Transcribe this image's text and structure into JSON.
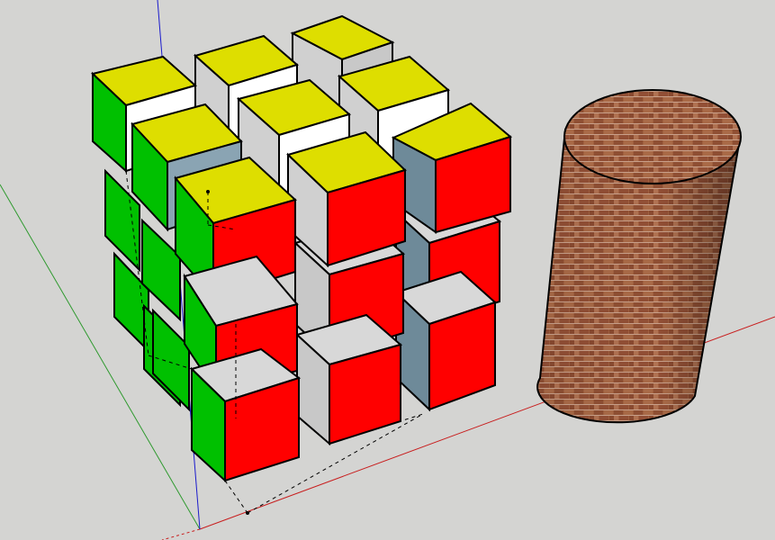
{
  "viewport": {
    "background": "#d4d4d2",
    "axis_colors": {
      "red": "#c81e1e",
      "green": "#2f9a2f",
      "blue": "#1a1acc"
    }
  },
  "model": {
    "cube": {
      "grid": "3x3x3",
      "face_colors": {
        "top": "#dede00",
        "front": "#ff0000",
        "left": "#00c000",
        "neutral": "#d0d0d0",
        "blue_grey": "#6e8a99"
      }
    },
    "cylinder": {
      "material": "brick",
      "brick_color": "#9c5a3c",
      "mortar_color": "#b98a6e"
    }
  }
}
